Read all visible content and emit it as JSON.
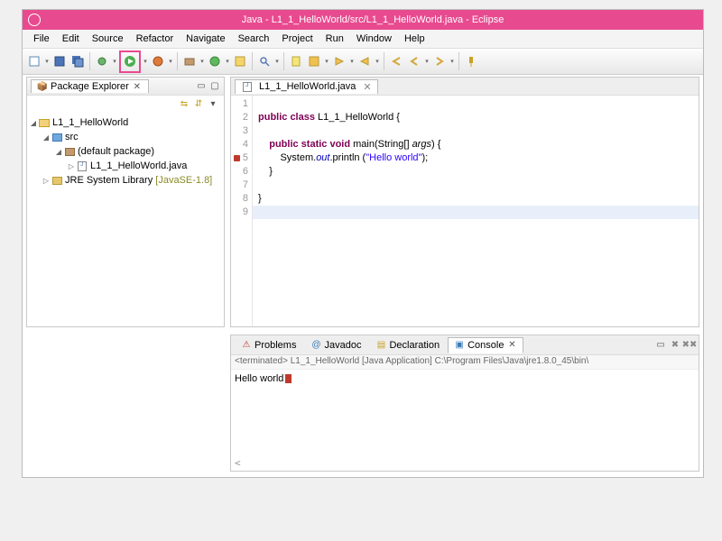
{
  "title": "Java - L1_1_HelloWorld/src/L1_1_HelloWorld.java - Eclipse",
  "menu": [
    "File",
    "Edit",
    "Source",
    "Refactor",
    "Navigate",
    "Search",
    "Project",
    "Run",
    "Window",
    "Help"
  ],
  "explorer": {
    "title": "Package Explorer",
    "project": "L1_1_HelloWorld",
    "src": "src",
    "pkg": "(default package)",
    "file": "L1_1_HelloWorld.java",
    "jre": "JRE System Library",
    "jre_ver": "[JavaSE-1.8]"
  },
  "editor": {
    "tab": "L1_1_HelloWorld.java",
    "lines": [
      "1",
      "2",
      "3",
      "4",
      "5",
      "6",
      "7",
      "8",
      "9"
    ],
    "code": {
      "l2a": "public class ",
      "l2b": "L1_1_HelloWorld {",
      "l4a": "    public static void ",
      "l4b": "main(String[] ",
      "l4c": "args",
      "l4d": ") {",
      "l5a": "        System.",
      "l5b": "out",
      "l5c": ".println (",
      "l5d": "\"Hello world\"",
      "l5e": ");",
      "l6": "    }",
      "l8": "}"
    }
  },
  "bottom": {
    "tab_problems": "Problems",
    "tab_javadoc": "Javadoc",
    "tab_declaration": "Declaration",
    "tab_console": "Console",
    "launch": "<terminated> L1_1_HelloWorld [Java Application] C:\\Program Files\\Java\\jre1.8.0_45\\bin\\",
    "output": "Hello world",
    "prompt": "<"
  }
}
